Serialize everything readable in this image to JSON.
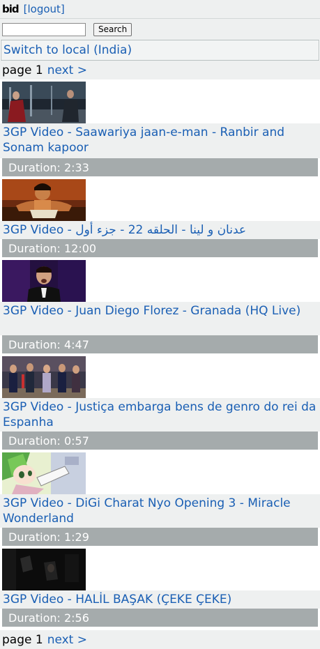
{
  "header": {
    "logo": "bid",
    "logout": "[logout]"
  },
  "search": {
    "placeholder": "",
    "value": "",
    "button": "Search"
  },
  "switch": {
    "label": "Switch to local (India)"
  },
  "pager": {
    "page_label": "page 1",
    "next": "next >"
  },
  "videos": [
    {
      "title": "3GP Video - Saawariya jaan-e-man - Ranbir and Sonam kapoor",
      "duration": "Duration: 2:33"
    },
    {
      "title": "3GP Video - عدنان و لينا - الحلقه 22 - جزء أول",
      "duration": "Duration: 12:00"
    },
    {
      "title": "3GP Video - Juan Diego Florez - Granada (HQ Live)",
      "duration": "Duration: 4:47"
    },
    {
      "title": "3GP Video - Justiça embarga bens de genro do rei da Espanha",
      "duration": "Duration: 0:57"
    },
    {
      "title": "3GP Video - DiGi Charat Nyo Opening 3 - Miracle Wonderland",
      "duration": "Duration: 1:29"
    },
    {
      "title": "3GP Video - HALİL BAŞAK (ÇEKE ÇEKE)",
      "duration": "Duration: 2:56"
    }
  ],
  "colors": {
    "link": "#1a5fb4",
    "duration_bar": "#a5abac",
    "row_bg": "#eef0f0"
  }
}
